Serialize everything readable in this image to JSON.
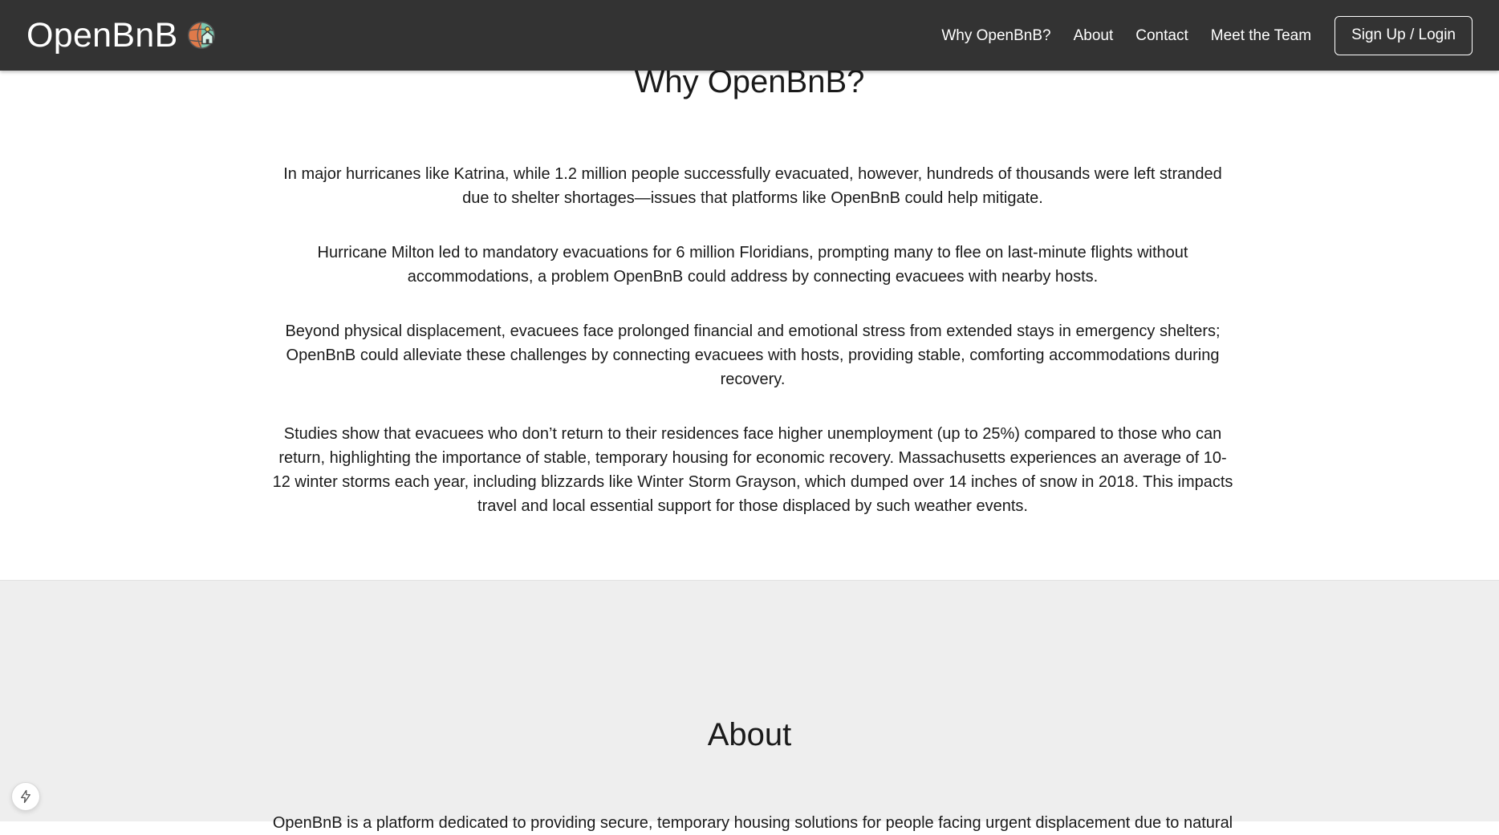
{
  "brand": {
    "name": "OpenBnB",
    "logo_icon": "globe-house-icon"
  },
  "nav": {
    "links": [
      {
        "label": "Why OpenBnB?"
      },
      {
        "label": "About"
      },
      {
        "label": "Contact"
      },
      {
        "label": "Meet the Team"
      }
    ],
    "login_label": "Sign Up / Login"
  },
  "why": {
    "title": "Why OpenBnB?",
    "paragraphs": [
      "In major hurricanes like Katrina, while 1.2 million people successfully evacuated, however, hundreds of thousands were left stranded due to shelter shortages—issues that platforms like OpenBnB could help mitigate.",
      "Hurricane Milton led to mandatory evacuations for 6 million Floridians, prompting many to flee on last-minute flights without accommodations, a problem OpenBnB could address by connecting evacuees with nearby hosts.",
      "Beyond physical displacement, evacuees face prolonged financial and emotional stress from extended stays in emergency shelters; OpenBnB could alleviate these challenges by connecting evacuees with hosts, providing stable, comforting accommodations during recovery.",
      "Studies show that evacuees who don’t return to their residences face higher unemployment (up to 25%) compared to those who can return, highlighting the importance of stable, temporary housing for economic recovery. Massachusetts experiences an average of 10-12 winter storms each year, including blizzards like Winter Storm Grayson, which dumped over 14 inches of snow in 2018. This impacts travel and local essential support for those displaced by such weather events."
    ]
  },
  "about": {
    "title": "About",
    "paragraph": "OpenBnB is a platform dedicated to providing secure, temporary housing solutions for people facing urgent displacement due to natural"
  },
  "floating_button": {
    "icon": "lightning-bolt-icon"
  },
  "colors": {
    "navbar_bg": "#333333",
    "about_bg": "#eeeeee",
    "text": "#1a1a1a"
  }
}
